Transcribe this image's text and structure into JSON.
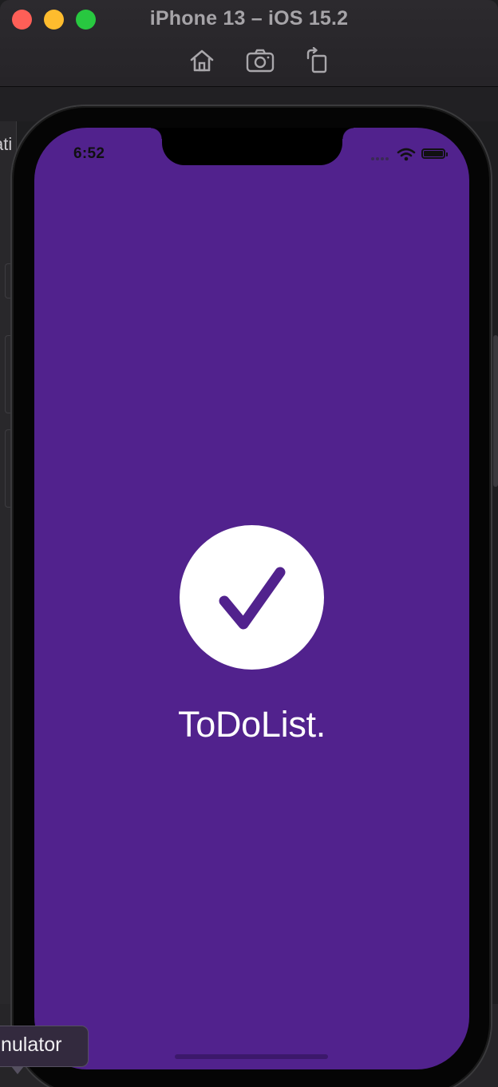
{
  "window": {
    "title": "iPhone 13 – iOS 15.2",
    "traffic_lights": {
      "close_color": "#fe5f57",
      "minimize_color": "#febc2e",
      "zoom_color": "#28c840"
    },
    "toolbar": [
      {
        "id": "home",
        "icon": "home-icon"
      },
      {
        "id": "screenshot",
        "icon": "camera-icon"
      },
      {
        "id": "rotate",
        "icon": "rotate-icon"
      }
    ]
  },
  "background": {
    "partial_label": "ati"
  },
  "device": {
    "status_bar": {
      "time": "6:52",
      "signal_icon": "cellular-dots-icon",
      "wifi_icon": "wifi-icon",
      "battery_icon": "battery-icon"
    },
    "splash": {
      "background_color": "#51228d",
      "logo_icon": "checkmark-circle-icon",
      "logo_color": "#ffffff",
      "check_color": "#51228d",
      "app_name": "ToDoList."
    }
  },
  "tooltip": {
    "text": "nulator"
  }
}
